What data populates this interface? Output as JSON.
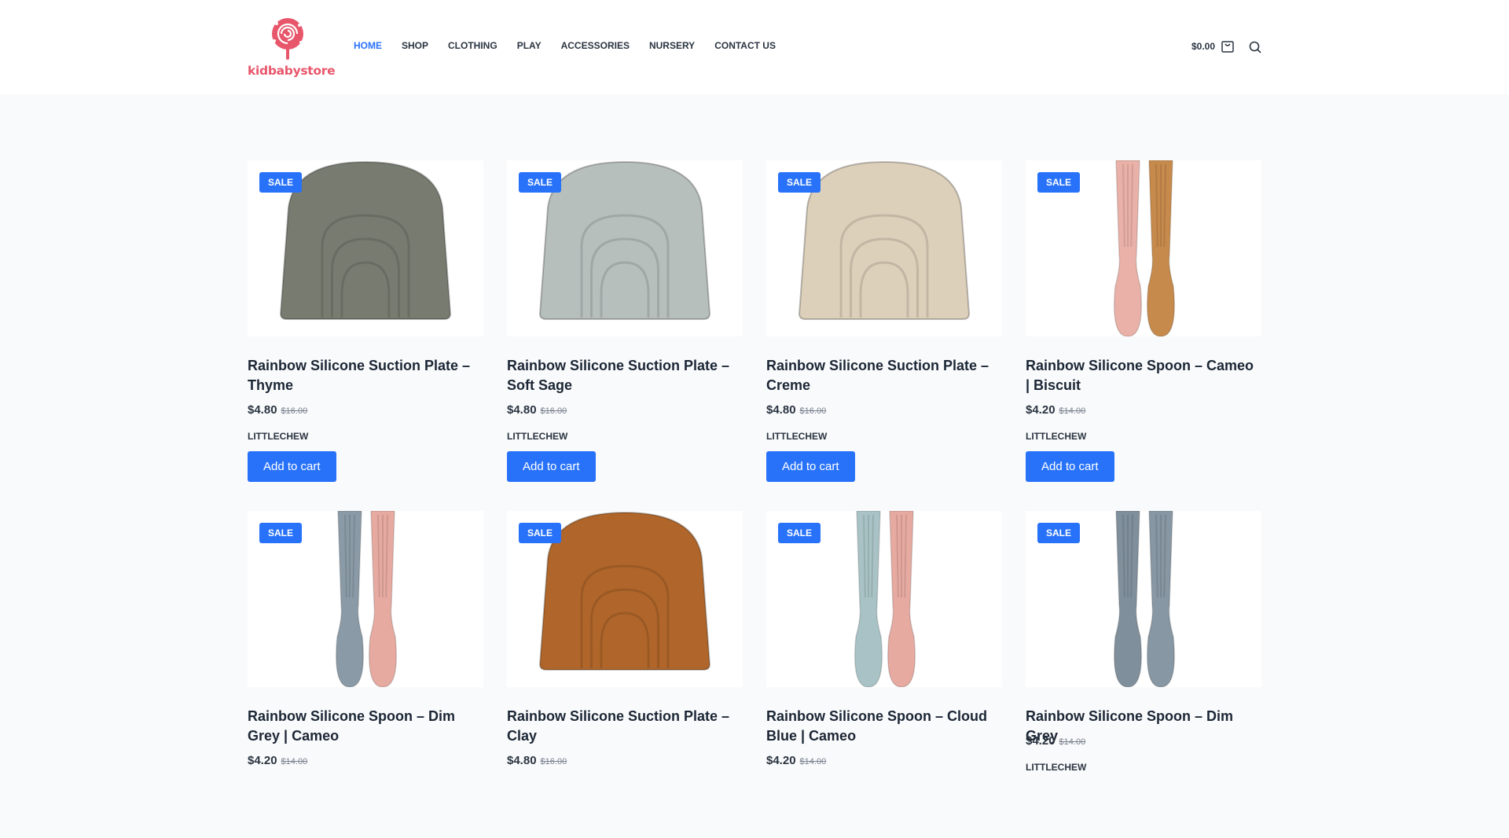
{
  "brand": {
    "logo_text": "kidbabystore",
    "logo_color": "#e8566b"
  },
  "nav": {
    "items": [
      "HOME",
      "SHOP",
      "CLOTHING",
      "PLAY",
      "ACCESSORIES",
      "NURSERY",
      "CONTACT US"
    ],
    "active": "HOME"
  },
  "cart": {
    "total": "$0.00",
    "icon": "shopping-bag-icon"
  },
  "search": {
    "icon": "search-icon"
  },
  "accent_color": "#2872fa",
  "products": [
    {
      "sale": "SALE",
      "title": "Rainbow Silicone Suction Plate – Thyme",
      "price": "$4.80",
      "old_price": "$16.00",
      "brand": "LITTLECHEW",
      "button": "Add to cart",
      "image": "plate",
      "colors": [
        "#777b70"
      ]
    },
    {
      "sale": "SALE",
      "title": "Rainbow Silicone Suction Plate – Soft Sage",
      "price": "$4.80",
      "old_price": "$16.00",
      "brand": "LITTLECHEW",
      "button": "Add to cart",
      "image": "plate",
      "colors": [
        "#b7bfbd"
      ]
    },
    {
      "sale": "SALE",
      "title": "Rainbow Silicone Suction Plate – Creme",
      "price": "$4.80",
      "old_price": "$16.00",
      "brand": "LITTLECHEW",
      "button": "Add to cart",
      "image": "plate",
      "colors": [
        "#ddd0bb"
      ]
    },
    {
      "sale": "SALE",
      "title": "Rainbow Silicone Spoon – Cameo | Biscuit",
      "price": "$4.20",
      "old_price": "$14.00",
      "brand": "LITTLECHEW",
      "button": "Add to cart",
      "image": "spoons",
      "colors": [
        "#e9b1a7",
        "#c68a4c"
      ]
    },
    {
      "sale": "SALE",
      "title": "Rainbow Silicone Spoon – Dim Grey | Cameo",
      "price": "$4.20",
      "old_price": "$14.00",
      "brand": "",
      "button": "",
      "image": "spoons",
      "colors": [
        "#8a9aa6",
        "#e6aaa1"
      ]
    },
    {
      "sale": "SALE",
      "title": "Rainbow Silicone Suction Plate – Clay",
      "price": "$4.80",
      "old_price": "$16.00",
      "brand": "",
      "button": "",
      "image": "plate",
      "colors": [
        "#b0662a"
      ]
    },
    {
      "sale": "SALE",
      "title": "Rainbow Silicone Spoon – Cloud Blue | Cameo",
      "price": "$4.20",
      "old_price": "$14.00",
      "brand": "",
      "button": "",
      "image": "spoons",
      "colors": [
        "#a9c2c5",
        "#e6aaa1"
      ]
    },
    {
      "sale": "SALE",
      "title": "Rainbow Silicone Spoon – Dim Grey",
      "price": "$4.20",
      "old_price": "$14.00",
      "brand": "LITTLECHEW",
      "button": "",
      "image": "spoons",
      "colors": [
        "#7f8f9b",
        "#8797a3"
      ]
    }
  ]
}
